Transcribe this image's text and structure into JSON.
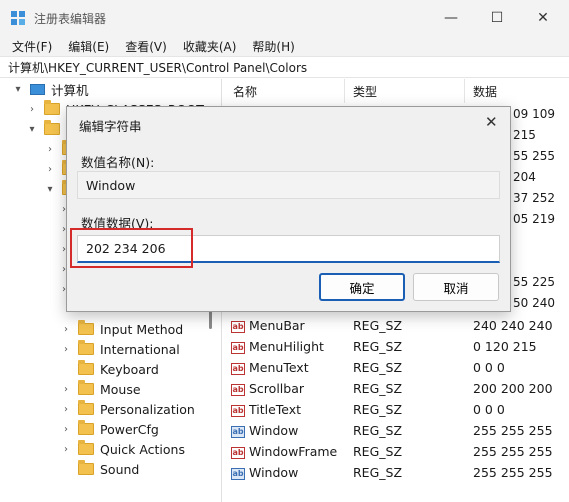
{
  "window": {
    "title": "注册表编辑器",
    "controls": {
      "minimize": "—",
      "maximize": "☐",
      "close": "✕"
    }
  },
  "menu": [
    "文件(F)",
    "编辑(E)",
    "查看(V)",
    "收藏夹(A)",
    "帮助(H)"
  ],
  "address": "计算机\\HKEY_CURRENT_USER\\Control Panel\\Colors",
  "tree": {
    "root": "计算机",
    "partial_top": "HKEY_CLASSES_ROOT",
    "partial_hk": "H",
    "items": [
      "Input Method",
      "International",
      "Keyboard",
      "Mouse",
      "Personalization",
      "PowerCfg",
      "Quick Actions",
      "Sound"
    ]
  },
  "columns": {
    "name": "名称",
    "type": "类型",
    "data": "数据"
  },
  "partial_values": [
    "09 109",
    "215",
    "55 255",
    "204",
    "37 252",
    "05 219",
    "55 225",
    "50 240"
  ],
  "rows": [
    {
      "name": "MenuBar",
      "type": "REG_SZ",
      "data": "240 240 240"
    },
    {
      "name": "MenuHilight",
      "type": "REG_SZ",
      "data": "0 120 215"
    },
    {
      "name": "MenuText",
      "type": "REG_SZ",
      "data": "0 0 0"
    },
    {
      "name": "Scrollbar",
      "type": "REG_SZ",
      "data": "200 200 200"
    },
    {
      "name": "TitleText",
      "type": "REG_SZ",
      "data": "0 0 0"
    },
    {
      "name": "Window",
      "type": "REG_SZ",
      "data": "255 255 255"
    },
    {
      "name": "WindowFrame",
      "type": "REG_SZ",
      "data": "255 255 255"
    },
    {
      "name": "Window",
      "type": "REG_SZ",
      "data": "255 255 255"
    }
  ],
  "dialog": {
    "title": "编辑字符串",
    "close": "✕",
    "name_label": "数值名称(N):",
    "name_value": "Window",
    "data_label": "数值数据(V):",
    "data_value": "202 234 206",
    "ok": "确定",
    "cancel": "取消"
  },
  "icons": {
    "string_value": "ab"
  },
  "colors": {
    "accent": "#1a5fb4",
    "highlight_box": "#d42a2a",
    "folder": "#f2c14e"
  }
}
